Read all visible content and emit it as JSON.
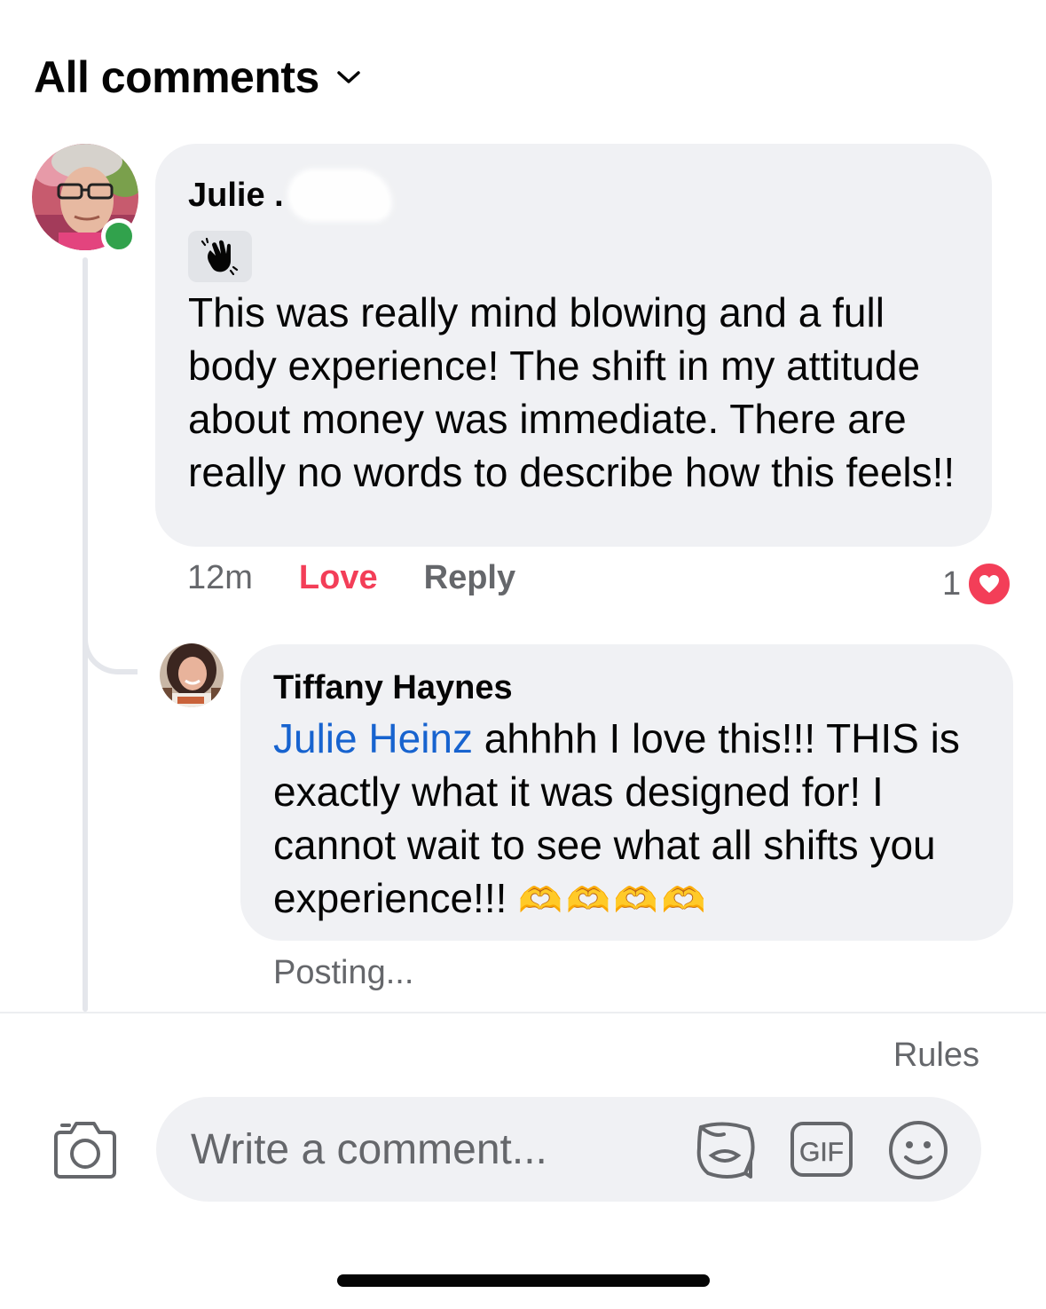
{
  "header": {
    "title": "All comments"
  },
  "comments": [
    {
      "author": "Julie",
      "author_suffix": ".",
      "badge_icon": "waving-hand-icon",
      "text": "This was really mind blowing and a full body experience! The shift in my attitude about money was immediate. There are really no words to describe how this feels!!",
      "timestamp": "12m",
      "love_label": "Love",
      "reply_label": "Reply",
      "reaction_count": "1",
      "reaction_icon": "love-heart-icon",
      "online": true
    },
    {
      "author": "Tiffany Haynes",
      "mention": "Julie Heinz",
      "text": " ahhhh I love this!!! THIS is exactly what it was designed for! I cannot wait to see what all shifts you experience!!! ",
      "emoji": "🫶🫶🫶🫶",
      "status": "Posting..."
    }
  ],
  "composer": {
    "rules_label": "Rules",
    "placeholder": "Write a comment...",
    "icons": [
      "camera-icon",
      "sticker-icon",
      "gif-icon",
      "emoji-icon"
    ],
    "gif_label": "GIF"
  },
  "colors": {
    "love": "#f33e58",
    "mention": "#1763cf",
    "bubble": "#f0f1f4",
    "secondary_text": "#65676b",
    "online": "#31a24c"
  }
}
